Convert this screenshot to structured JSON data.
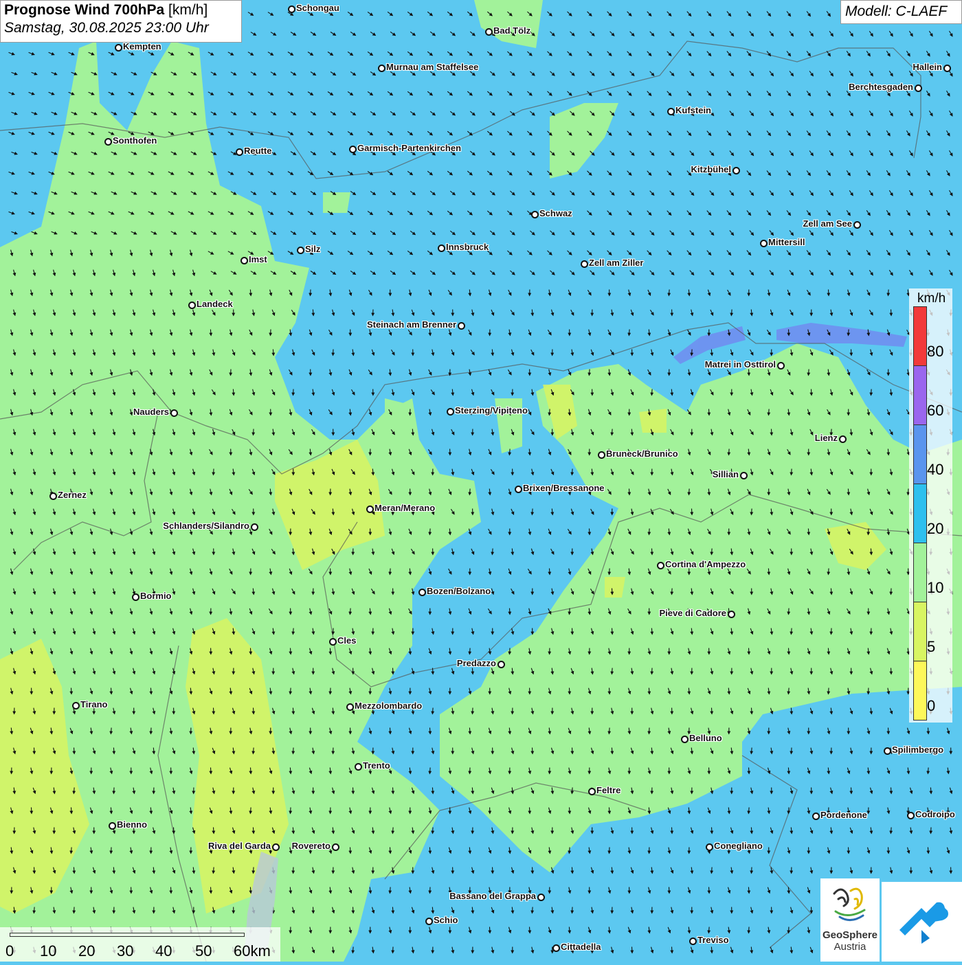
{
  "title": {
    "main": "Prognose Wind 700hPa",
    "unit": "[km/h]",
    "datetime": "Samstag, 30.08.2025 23:00 Uhr"
  },
  "model": "Modell: C-LAEF",
  "legend": {
    "unit": "km/h",
    "labels": [
      "80",
      "60",
      "40",
      "20",
      "10",
      "5",
      "0"
    ],
    "colors": [
      "#f23a3a",
      "#9a66ee",
      "#5a95ee",
      "#2ec0ee",
      "#a2f29a",
      "#d8f562",
      "#fdf85a"
    ]
  },
  "scale": {
    "labels": [
      "0",
      "10",
      "20",
      "30",
      "40",
      "50",
      "60km"
    ]
  },
  "logo": {
    "line1": "GeoSphere",
    "line2": "Austria"
  },
  "cities": [
    {
      "name": "Schongau"
    },
    {
      "name": "Bad Tölz"
    },
    {
      "name": "Kempten"
    },
    {
      "name": "Murnau am Staffelsee"
    },
    {
      "name": "Hallein"
    },
    {
      "name": "Berchtesgaden"
    },
    {
      "name": "Kufstein"
    },
    {
      "name": "Sonthofen"
    },
    {
      "name": "Reutte"
    },
    {
      "name": "Garmisch-Partenkirchen"
    },
    {
      "name": "Kitzbühel"
    },
    {
      "name": "Schwaz"
    },
    {
      "name": "Zell am See"
    },
    {
      "name": "Mittersill"
    },
    {
      "name": "Imst"
    },
    {
      "name": "Silz"
    },
    {
      "name": "Innsbruck"
    },
    {
      "name": "Zell am Ziller"
    },
    {
      "name": "Landeck"
    },
    {
      "name": "Steinach am Brenner"
    },
    {
      "name": "Matrei in Osttirol"
    },
    {
      "name": "Nauders"
    },
    {
      "name": "Sterzing/Vipiteno"
    },
    {
      "name": "Lienz"
    },
    {
      "name": "Bruneck/Brunico"
    },
    {
      "name": "Sillian"
    },
    {
      "name": "Brixen/Bressanone"
    },
    {
      "name": "Zernez"
    },
    {
      "name": "Meran/Merano"
    },
    {
      "name": "Schlanders/Silandro"
    },
    {
      "name": "Cortina d'Ampezzo"
    },
    {
      "name": "Bozen/Bolzano"
    },
    {
      "name": "Bormio"
    },
    {
      "name": "Pieve di Cadore"
    },
    {
      "name": "Cles"
    },
    {
      "name": "Predazzo"
    },
    {
      "name": "Tirano"
    },
    {
      "name": "Mezzolombardo"
    },
    {
      "name": "Belluno"
    },
    {
      "name": "Spilimbergo"
    },
    {
      "name": "Trento"
    },
    {
      "name": "Feltre"
    },
    {
      "name": "Pordenone"
    },
    {
      "name": "Codroipo"
    },
    {
      "name": "Bienno"
    },
    {
      "name": "Riva del Garda"
    },
    {
      "name": "Rovereto"
    },
    {
      "name": "Conegliano"
    },
    {
      "name": "Bassano del Grappa"
    },
    {
      "name": "Schio"
    },
    {
      "name": "Treviso"
    },
    {
      "name": "Cittadella"
    }
  ]
}
